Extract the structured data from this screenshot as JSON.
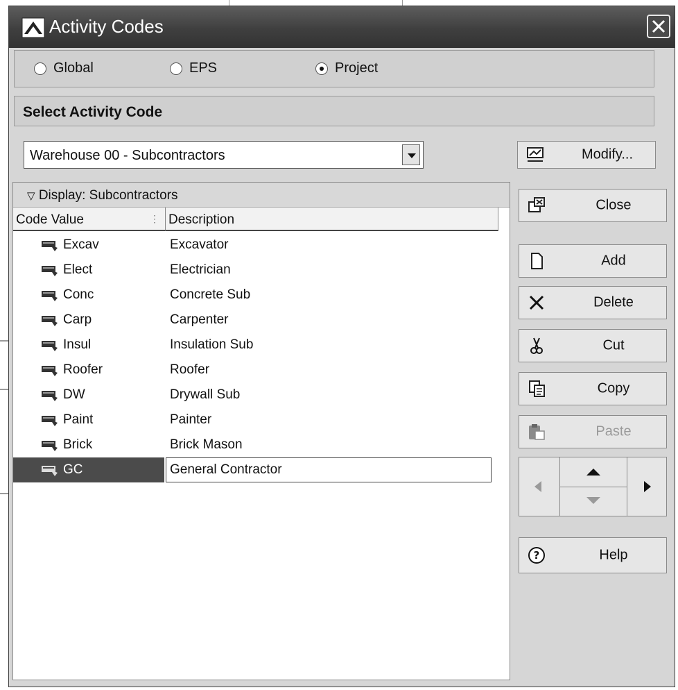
{
  "window": {
    "title": "Activity Codes"
  },
  "scope": {
    "options": [
      {
        "label": "Global",
        "selected": false
      },
      {
        "label": "EPS",
        "selected": false
      },
      {
        "label": "Project",
        "selected": true
      }
    ]
  },
  "select_section": {
    "header": "Select Activity Code",
    "selected_code": "Warehouse 00 - Subcontractors"
  },
  "list": {
    "display_label": "Display: Subcontractors",
    "columns": [
      "Code Value",
      "Description"
    ],
    "rows": [
      {
        "code": "Excav",
        "description": "Excavator"
      },
      {
        "code": "Elect",
        "description": "Electrician"
      },
      {
        "code": "Conc",
        "description": "Concrete Sub"
      },
      {
        "code": "Carp",
        "description": "Carpenter"
      },
      {
        "code": "Insul",
        "description": "Insulation Sub"
      },
      {
        "code": "Roofer",
        "description": "Roofer"
      },
      {
        "code": "DW",
        "description": "Drywall Sub"
      },
      {
        "code": "Paint",
        "description": "Painter"
      },
      {
        "code": "Brick",
        "description": "Brick Mason"
      },
      {
        "code": "GC",
        "description": "General Contractor",
        "selected": true
      }
    ]
  },
  "buttons": {
    "modify": "Modify...",
    "close": "Close",
    "add": "Add",
    "delete": "Delete",
    "cut": "Cut",
    "copy": "Copy",
    "paste": "Paste",
    "help": "Help"
  },
  "icons": [
    "activity-codes-icon",
    "close-icon",
    "modify-icon",
    "close-dialog-icon",
    "add-icon",
    "delete-icon",
    "cut-icon",
    "copy-icon",
    "paste-icon",
    "help-icon",
    "code-tag-icon",
    "arrow-left-icon",
    "arrow-up-icon",
    "arrow-down-icon",
    "arrow-right-icon"
  ],
  "colors": {
    "titlebar": "#3f3f3f",
    "selected_row": "#4b4b4b",
    "dialog_bg": "#d6d6d6"
  }
}
